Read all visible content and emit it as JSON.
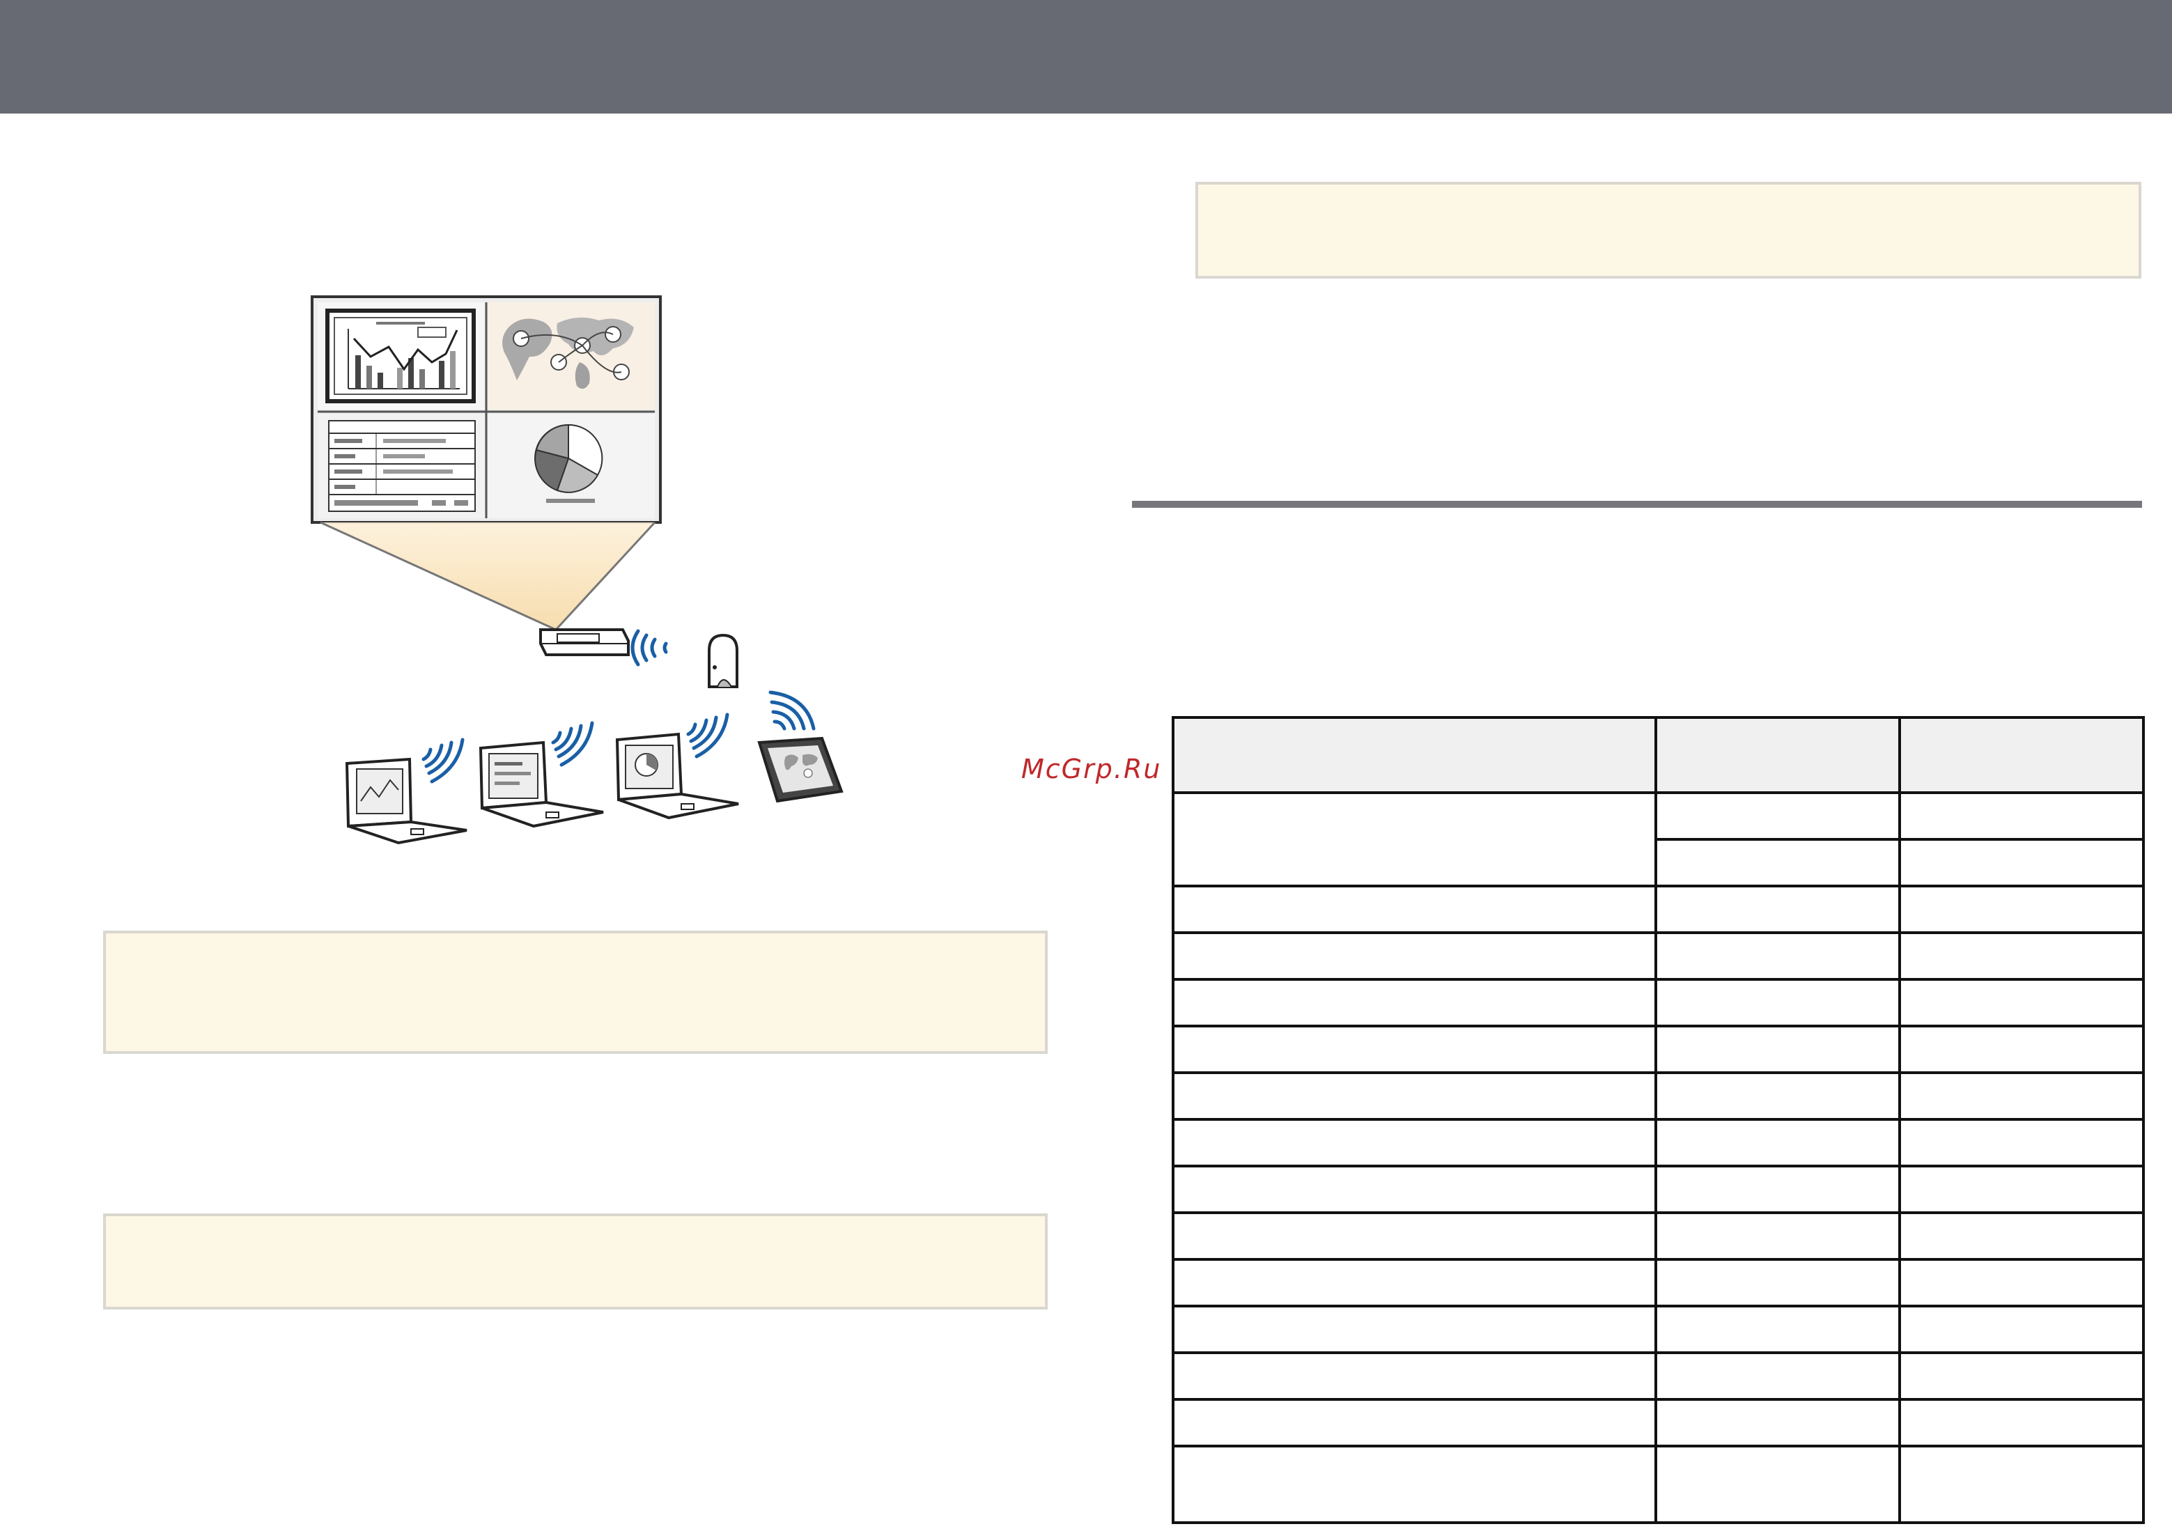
{
  "watermark": "McGrp.Ru",
  "colors": {
    "header_bar": "#686a73",
    "note_background": "#fdf7e6",
    "note_border": "#d9d7cf",
    "section_rule": "#77777b",
    "wifi_waves": "#1a5fa6",
    "watermark": "#c0282a",
    "table_header": "#f0f0f0"
  },
  "illustration": {
    "icons": [
      "projection-screen",
      "projector-icon",
      "access-point-icon",
      "laptop-icon",
      "laptop-icon",
      "laptop-icon",
      "tablet-icon",
      "wifi-icon"
    ]
  }
}
